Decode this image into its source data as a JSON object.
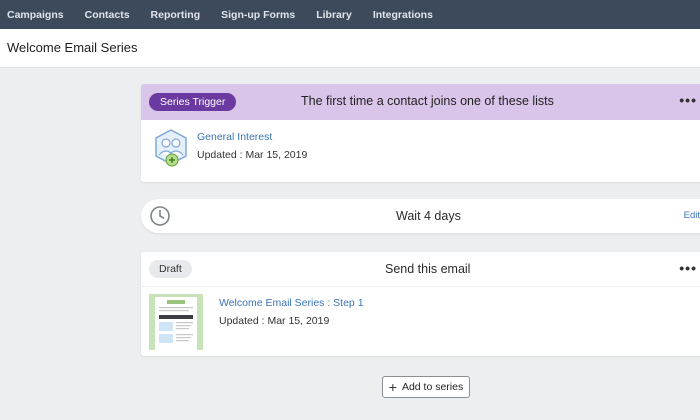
{
  "nav": {
    "items": [
      "Campaigns",
      "Contacts",
      "Reporting",
      "Sign-up Forms",
      "Library",
      "Integrations"
    ]
  },
  "page": {
    "title": "Welcome Email Series"
  },
  "trigger": {
    "badge": "Series Trigger",
    "title": "The first time a contact joins one of these lists",
    "list_name": "General Interest",
    "updated": "Updated : Mar 15, 2019",
    "menu_icon": "more-horizontal-icon"
  },
  "wait": {
    "title": "Wait 4 days",
    "edit_label": "Edit",
    "icon": "clock-icon"
  },
  "email": {
    "badge": "Draft",
    "title": "Send this email",
    "name": "Welcome Email Series : Step 1",
    "updated": "Updated : Mar 15, 2019",
    "menu_icon": "more-horizontal-icon"
  },
  "actions": {
    "add_label": "Add to series"
  },
  "colors": {
    "nav_bg": "#3c4a5c",
    "trigger_header_bg": "#d9c4ea",
    "trigger_badge_bg": "#6a3aa0",
    "link": "#3b74b5"
  }
}
